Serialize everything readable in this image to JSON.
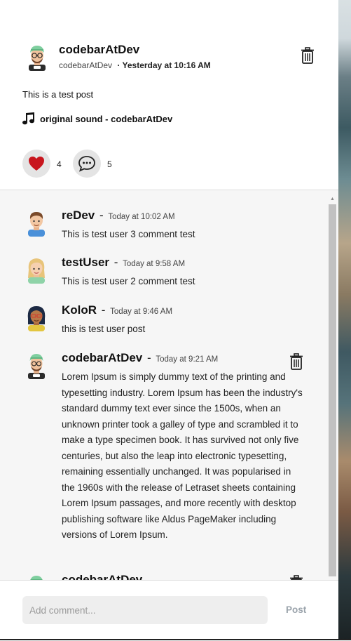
{
  "post": {
    "username": "codebarAtDev",
    "handle": "codebarAtDev",
    "time": "Yesterday at 10:16 AM",
    "text": "This is a test post",
    "sound": "original sound - codebarAtDev",
    "likes": "4",
    "comments_count": "5"
  },
  "comments": [
    {
      "name": "reDev",
      "time": "Today at 10:02 AM",
      "text": "This is test user 3 comment test",
      "deletable": false
    },
    {
      "name": "testUser",
      "time": "Today at 9:58 AM",
      "text": "This is test user 2 comment test",
      "deletable": false
    },
    {
      "name": "KoloR",
      "time": "Today at 9:46 AM",
      "text": "this is test user post",
      "deletable": false
    },
    {
      "name": "codebarAtDev",
      "time": "Today at 9:21 AM",
      "text": "Lorem Ipsum is simply dummy text of the printing and typesetting industry. Lorem Ipsum has been the industry's standard dummy text ever since the 1500s, when an unknown printer took a galley of type and scrambled it to make a type specimen book. It has survived not only five centuries, but also the leap into electronic typesetting, remaining essentially unchanged. It was popularised in the 1960s with the release of Letraset sheets containing Lorem Ipsum passages, and more recently with desktop publishing software like Aldus PageMaker including versions of Lorem Ipsum.",
      "deletable": true
    },
    {
      "name": "codebarAtDev",
      "time": "",
      "text": "",
      "deletable": true
    }
  ],
  "add_comment": {
    "placeholder": "Add comment...",
    "post_label": "Post"
  },
  "colors": {
    "heart": "#c8161e",
    "action_bg": "#e4e4e4",
    "post_button": "#9aa3ab"
  }
}
